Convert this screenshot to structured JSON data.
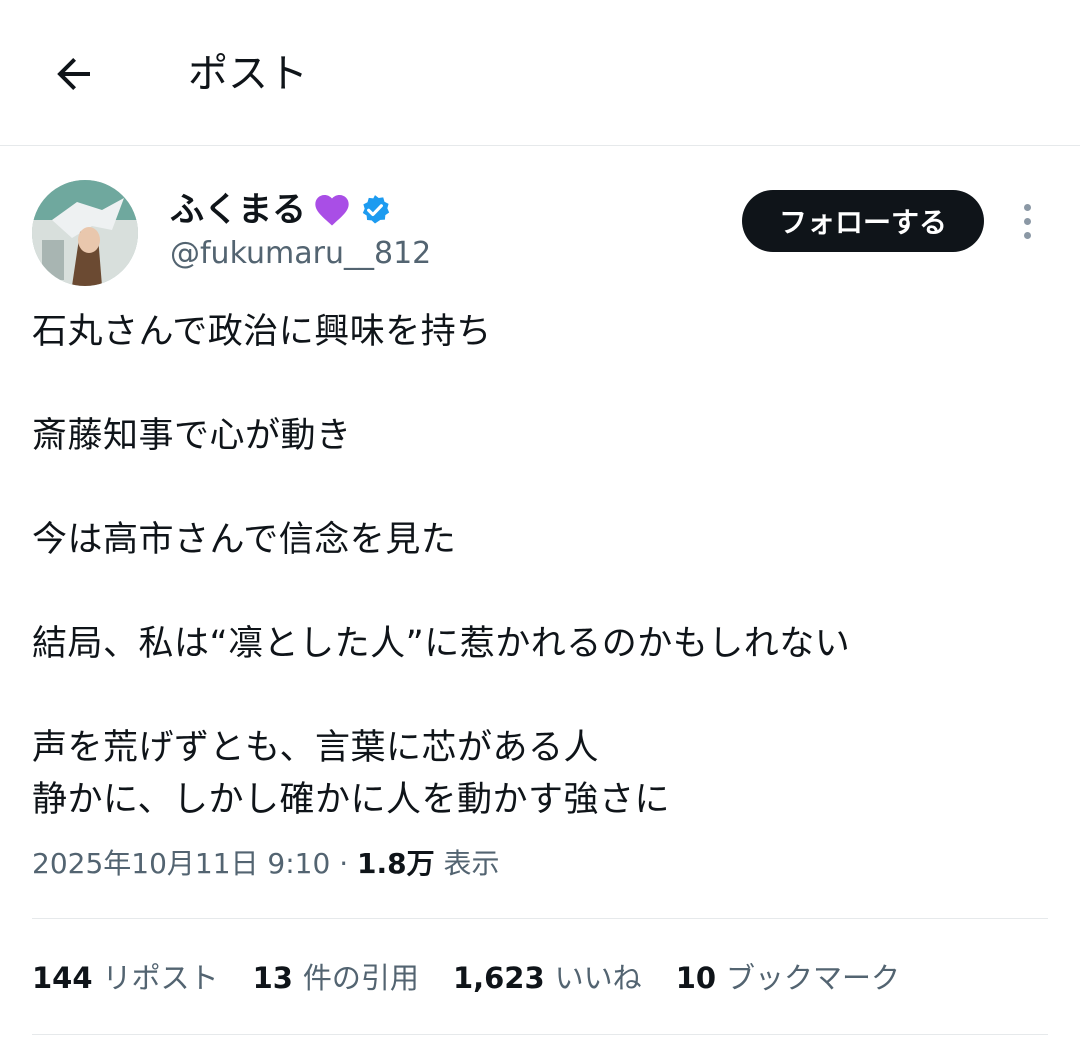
{
  "header": {
    "title": "ポスト"
  },
  "author": {
    "display_name": "ふくまる",
    "emoji": "💜",
    "handle": "@fukumaru__812",
    "verified": true
  },
  "follow_label": "フォローする",
  "post": {
    "lines": [
      "石丸さんで政治に興味を持ち",
      "斎藤知事で心が動き",
      "今は高市さんで信念を見た",
      "結局、私は“凛とした人”に惹かれるのかもしれない",
      "声を荒げずとも、言葉に芯がある人",
      "静かに、しかし確かに人を動かす強さに"
    ]
  },
  "meta": {
    "datetime": "2025年10月11日 9:10",
    "separator": "·",
    "views": "1.8万",
    "views_label": "表示"
  },
  "stats": [
    {
      "value": "144",
      "label": "リポスト"
    },
    {
      "value": "13",
      "label": "件の引用"
    },
    {
      "value": "1,623",
      "label": "いいね"
    },
    {
      "value": "10",
      "label": "ブックマーク"
    }
  ],
  "colors": {
    "verified": "#1d9bf0",
    "text": "#0f1419",
    "secondary": "#536471",
    "button": "#0f1419"
  }
}
